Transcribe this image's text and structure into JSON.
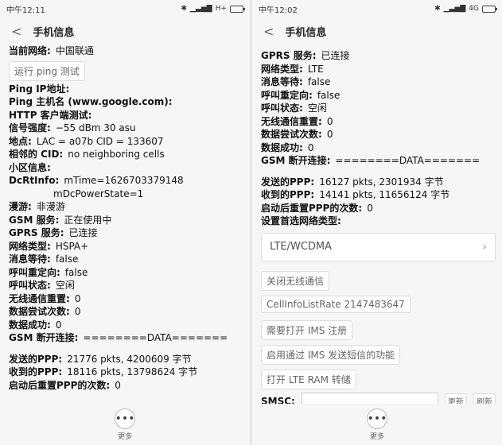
{
  "left_phone": {
    "status_time": "中午12:11",
    "network": "H+",
    "title": "手机信息",
    "rows_top": [
      {
        "label": "当前网络:",
        "value": "中国联通"
      }
    ],
    "ping_button": "运行 ping 测试",
    "rows": [
      {
        "label": "Ping IP地址:",
        "value": ""
      },
      {
        "label": "Ping 主机名 (www.google.com):",
        "value": ""
      },
      {
        "label": "HTTP 客户端测试:",
        "value": ""
      },
      {
        "label": "信号强度:",
        "value": "−55 dBm   30 asu"
      },
      {
        "label": "地点:",
        "value": "LAC = a07b   CID = 133607"
      },
      {
        "label": "相邻的 CID:",
        "value": "no neighboring cells"
      },
      {
        "label": "小区信息:",
        "value": ""
      },
      {
        "label": "DcRtInfo:",
        "value": "mTime=1626703379148"
      },
      {
        "label": "",
        "value": "mDcPowerState=1"
      },
      {
        "label": "漫游:",
        "value": "非漫游"
      },
      {
        "label": "GSM 服务:",
        "value": "正在使用中"
      },
      {
        "label": "GPRS 服务:",
        "value": "已连接"
      },
      {
        "label": "网络类型:",
        "value": "HSPA+"
      },
      {
        "label": "消息等待:",
        "value": "false"
      },
      {
        "label": "呼叫重定向:",
        "value": "false"
      },
      {
        "label": "呼叫状态:",
        "value": "空闲"
      },
      {
        "label": "无线通信重置:",
        "value": "0"
      },
      {
        "label": "数据尝试次数:",
        "value": "0"
      },
      {
        "label": "数据成功:",
        "value": "0"
      },
      {
        "label": "GSM 断开连接:",
        "value": "========DATA======="
      }
    ],
    "rows_bottom": [
      {
        "label": "发送的PPP:",
        "value": "21776 pkts, 4200609 字节"
      },
      {
        "label": "收到的PPP:",
        "value": "18116 pkts, 13798624 字节"
      },
      {
        "label": "启动后重置PPP的次数:",
        "value": "0"
      }
    ],
    "more_label": "更多"
  },
  "right_phone": {
    "status_time": "中午12:02",
    "network": "4G",
    "title": "手机信息",
    "rows": [
      {
        "label": "GPRS 服务:",
        "value": "已连接"
      },
      {
        "label": "网络类型:",
        "value": "LTE"
      },
      {
        "label": "消息等待:",
        "value": "false"
      },
      {
        "label": "呼叫重定向:",
        "value": "false"
      },
      {
        "label": "呼叫状态:",
        "value": "空闲"
      },
      {
        "label": "无线通信重置:",
        "value": "0"
      },
      {
        "label": "数据尝试次数:",
        "value": "0"
      },
      {
        "label": "数据成功:",
        "value": "0"
      },
      {
        "label": "GSM 断开连接:",
        "value": "========DATA======="
      }
    ],
    "rows_bottom": [
      {
        "label": "发送的PPP:",
        "value": "16127 pkts, 2301934 字节"
      },
      {
        "label": "收到的PPP:",
        "value": "14141 pkts, 11656124 字节"
      },
      {
        "label": "启动后重置PPP的次数:",
        "value": "0"
      },
      {
        "label": "设置首选网络类型:",
        "value": ""
      }
    ],
    "preferred_network": "LTE/WCDMA",
    "buttons": [
      "关闭无线通信",
      "CellInfoListRate 2147483647",
      "需要打开 IMS 注册",
      "启用通过 IMS 发送短信的功能",
      "打开 LTE RAM 转储"
    ],
    "smsc_label": "SMSC:",
    "smsc_update": "更新",
    "smsc_refresh": "刷新",
    "more_label": "更多"
  }
}
